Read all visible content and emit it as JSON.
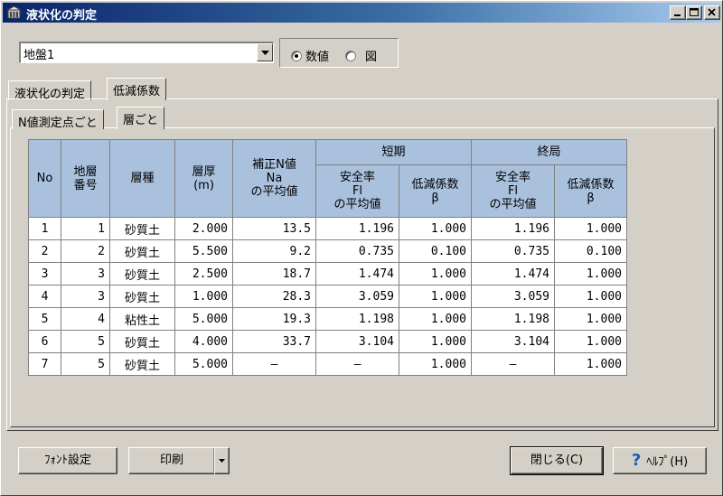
{
  "window": {
    "title": "液状化の判定"
  },
  "ground_select": {
    "value": "地盤1"
  },
  "view_mode": {
    "numeric_label": "数値",
    "figure_label": "図",
    "selected": "numeric"
  },
  "tabs": [
    {
      "label": "液状化の判定"
    },
    {
      "label": "低減係数"
    }
  ],
  "subtabs": [
    {
      "label": "N値測定点ごと"
    },
    {
      "label": "層ごと"
    }
  ],
  "table": {
    "headers": {
      "no": "No",
      "layer_num": [
        "地層",
        "番号"
      ],
      "soil_type": "層種",
      "thickness": [
        "層厚",
        "(m)"
      ],
      "n_value": [
        "補正N値",
        "Na",
        "の平均値"
      ],
      "short_term": "短期",
      "ultimate": "終局",
      "fl_avg": [
        "安全率",
        "Fl",
        "の平均値"
      ],
      "reduction": [
        "低減係数",
        "β"
      ]
    },
    "rows": [
      [
        "1",
        "1",
        "砂質土",
        "2.000",
        "13.5",
        "1.196",
        "1.000",
        "1.196",
        "1.000"
      ],
      [
        "2",
        "2",
        "砂質土",
        "5.500",
        "9.2",
        "0.735",
        "0.100",
        "0.735",
        "0.100"
      ],
      [
        "3",
        "3",
        "砂質土",
        "2.500",
        "18.7",
        "1.474",
        "1.000",
        "1.474",
        "1.000"
      ],
      [
        "4",
        "3",
        "砂質土",
        "1.000",
        "28.3",
        "3.059",
        "1.000",
        "3.059",
        "1.000"
      ],
      [
        "5",
        "4",
        "粘性土",
        "5.000",
        "19.3",
        "1.198",
        "1.000",
        "1.198",
        "1.000"
      ],
      [
        "6",
        "5",
        "砂質土",
        "4.000",
        "33.7",
        "3.104",
        "1.000",
        "3.104",
        "1.000"
      ],
      [
        "7",
        "5",
        "砂質土",
        "5.000",
        "—",
        "—",
        "1.000",
        "—",
        "1.000"
      ]
    ]
  },
  "buttons": {
    "font_settings": "ﾌｫﾝﾄ設定",
    "print": "印刷",
    "close": "閉じる(C)",
    "help": "ﾍﾙﾌﾟ(H)"
  }
}
